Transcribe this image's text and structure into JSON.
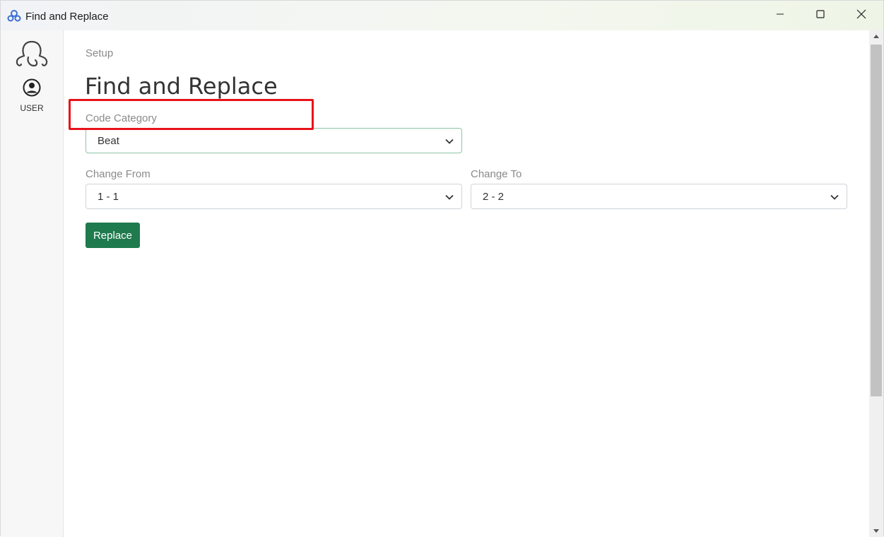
{
  "window": {
    "title": "Find and Replace",
    "icon": "app-logo-icon",
    "controls": [
      "minimize-icon",
      "maximize-icon",
      "close-icon"
    ]
  },
  "sidebar": {
    "logo": "octopus-logo-icon",
    "user_label": "USER",
    "user_icon": "user-circle-icon"
  },
  "main": {
    "breadcrumb": "Setup",
    "title": "Find and Replace",
    "code_category": {
      "label": "Code Category",
      "value": "Beat"
    },
    "change_from": {
      "label": "Change From",
      "value": "1 - 1"
    },
    "change_to": {
      "label": "Change To",
      "value": "2 - 2"
    },
    "replace_label": "Replace"
  },
  "colors": {
    "accent": "#1f7a4e",
    "highlight": "#e8131a",
    "focus_border": "#8dc4a8"
  }
}
